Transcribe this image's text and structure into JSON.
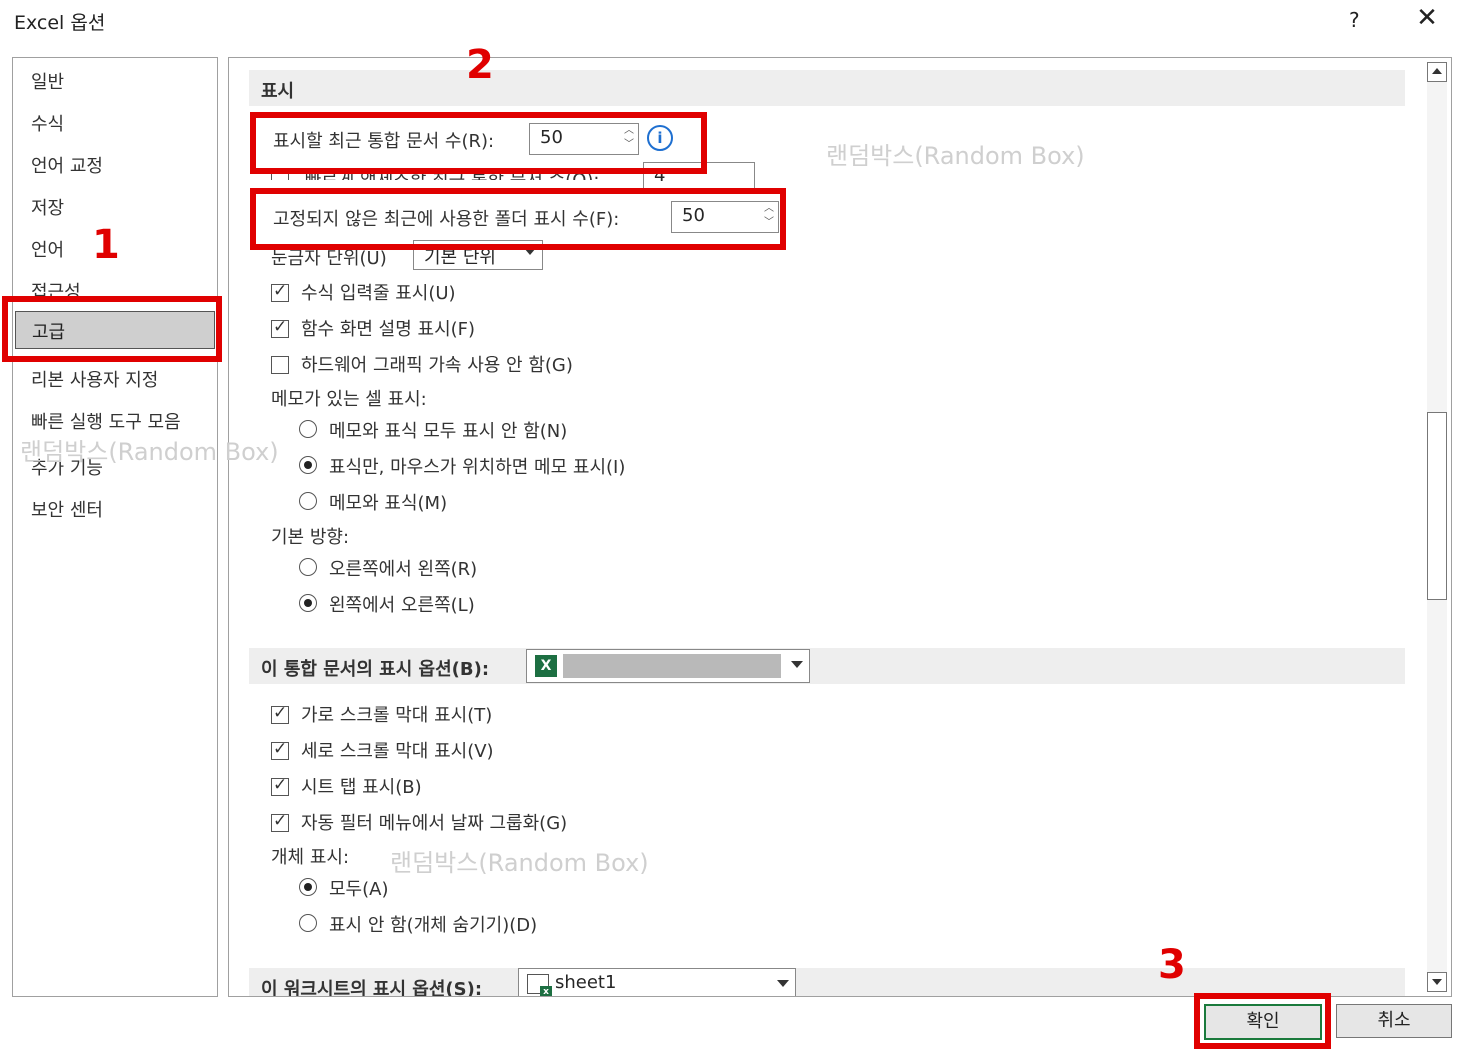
{
  "window": {
    "title": "Excel 옵션",
    "help": "?",
    "close": "✕"
  },
  "nav": {
    "items": [
      "일반",
      "수식",
      "언어 교정",
      "저장",
      "언어",
      "접근성",
      "고급",
      "리본 사용자 지정",
      "빠른 실행 도구 모음",
      "추가 기능",
      "보안 센터"
    ],
    "selected": "고급"
  },
  "sections": {
    "display": {
      "header": "표시",
      "recent_docs_label": "표시할 최근 통합 문서 수(R):",
      "recent_docs_value": "50",
      "quick_access_label": "빠르게 액세스할 최근 통합 문서 수(Q):",
      "quick_access_value": "4",
      "unpinned_folders_label": "고정되지 않은 최근에 사용한 폴더 표시 수(F):",
      "unpinned_folders_value": "50",
      "ruler_units_label": "눈금자 단위(U)",
      "ruler_units_value": "기본 단위",
      "formula_bar": "수식 입력줄 표시(U)",
      "function_tips": "함수 화면 설명 표시(F)",
      "hw_accel": "하드웨어 그래픽 가속 사용 안 함(G)",
      "comments_label": "메모가 있는 셀 표시:",
      "comments_none": "메모와 표식 모두 표시 안 함(N)",
      "comments_indicator": "표식만, 마우스가 위치하면 메모 표시(I)",
      "comments_both": "메모와 표식(M)",
      "direction_label": "기본 방향:",
      "dir_rtl": "오른쪽에서 왼쪽(R)",
      "dir_ltr": "왼쪽에서 오른쪽(L)"
    },
    "workbook": {
      "header": "이 통합 문서의 표시 옵션(B):",
      "h_scroll": "가로 스크롤 막대 표시(T)",
      "v_scroll": "세로 스크롤 막대 표시(V)",
      "sheet_tabs": "시트 탭 표시(B)",
      "autofilter": "자동 필터 메뉴에서 날짜 그룹화(G)",
      "objects_label": "개체 표시:",
      "objects_all": "모두(A)",
      "objects_none": "표시 안 함(개체 숨기기)(D)"
    },
    "worksheet": {
      "header": "이 워크시트의 표시 옵션(S):",
      "sheet": "sheet1"
    }
  },
  "buttons": {
    "ok": "확인",
    "cancel": "취소"
  },
  "markers": [
    "1",
    "2",
    "3"
  ],
  "watermark": "랜덤박스(Random Box)",
  "colors": {
    "highlight": "#e00000",
    "info": "#1e6fd0",
    "excel_green": "#1d6f42"
  }
}
